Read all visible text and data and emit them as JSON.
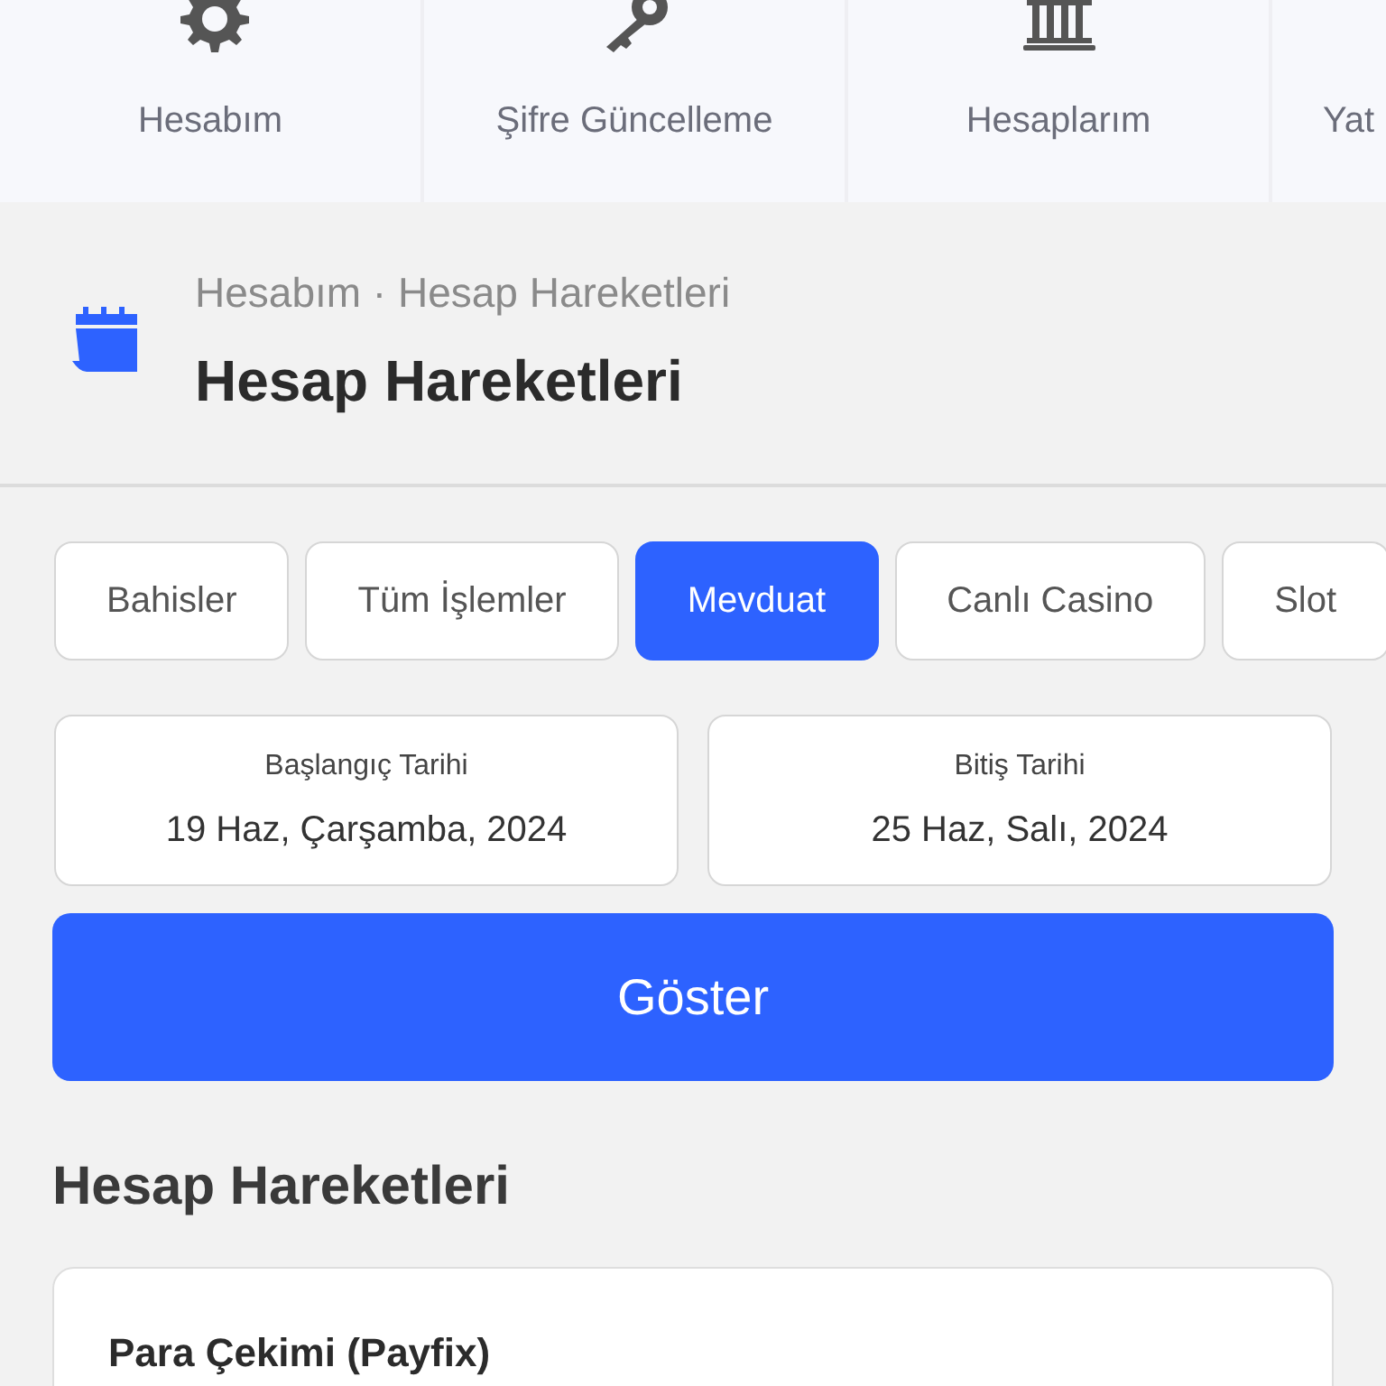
{
  "top_menu": [
    {
      "kind": "gear",
      "label": "Hesabım"
    },
    {
      "kind": "key",
      "label": "Şifre Güncelleme"
    },
    {
      "kind": "bank",
      "label": "Hesaplarım"
    },
    {
      "kind": "none",
      "label": "Yat"
    }
  ],
  "header": {
    "breadcrumb": "Hesabım · Hesap Hareketleri",
    "title": "Hesap Hareketleri"
  },
  "filters": [
    {
      "label": "Bahisler",
      "selected": false
    },
    {
      "label": "Tüm İşlemler",
      "selected": false
    },
    {
      "label": "Mevduat",
      "selected": true
    },
    {
      "label": "Canlı Casino",
      "selected": false
    },
    {
      "label": "Slot",
      "selected": false
    }
  ],
  "dates": [
    {
      "label": "Başlangıç Tarihi",
      "value": "19 Haz, Çarşamba, 2024"
    },
    {
      "label": "Bitiş Tarihi",
      "value": "25 Haz, Salı, 2024"
    }
  ],
  "show_button": "Göster",
  "section_title": "Hesap Hareketleri",
  "transactions": [
    {
      "title": "Para Çekimi (Payfix)"
    }
  ]
}
